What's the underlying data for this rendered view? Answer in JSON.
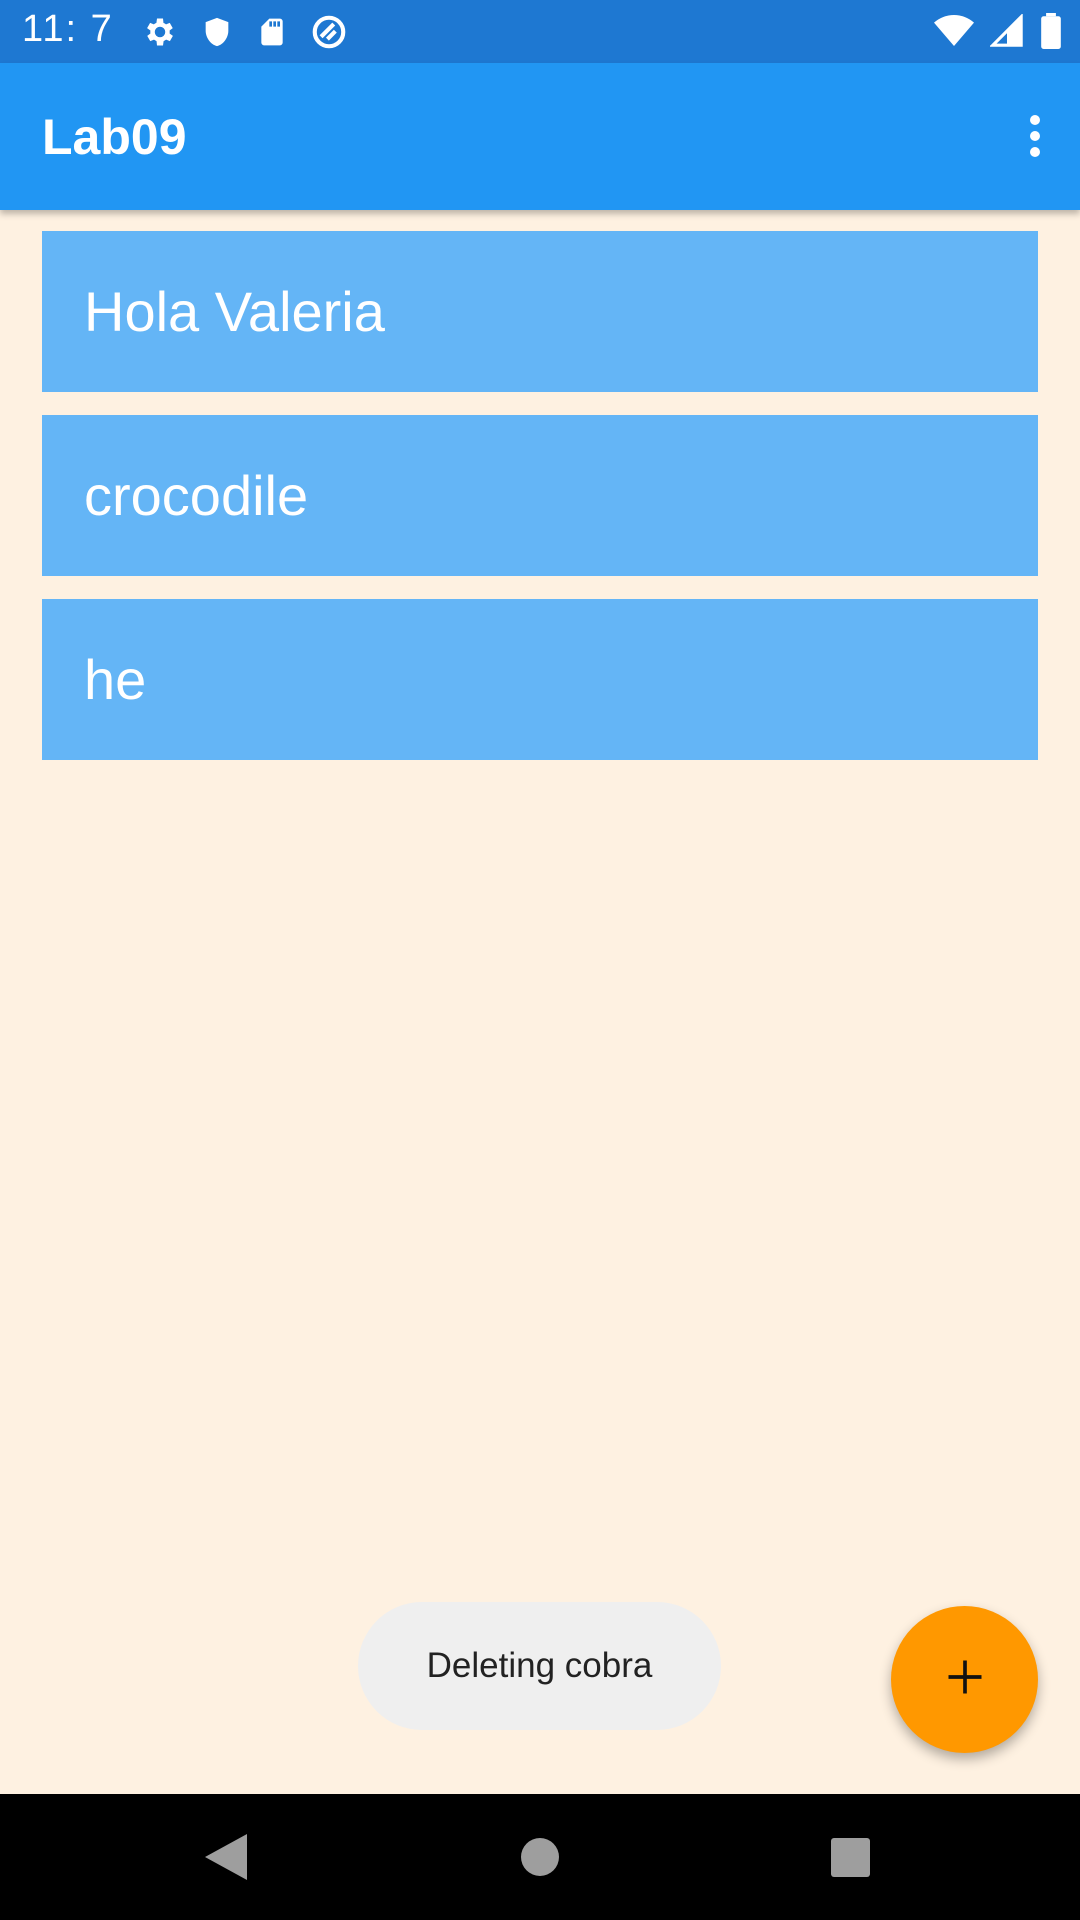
{
  "status_bar": {
    "time": "11:  7",
    "left_icons": [
      "settings-icon",
      "shield-icon",
      "sd-card-icon",
      "sync-icon"
    ],
    "right_icons": [
      "wifi-icon",
      "signal-icon",
      "battery-icon"
    ]
  },
  "app_bar": {
    "title": "Lab09",
    "menu_icon": "more-vert-icon"
  },
  "list": {
    "items": [
      {
        "label": "Hola Valeria"
      },
      {
        "label": "crocodile"
      },
      {
        "label": "he"
      }
    ]
  },
  "toast": {
    "message": "Deleting cobra"
  },
  "fab": {
    "icon": "add-icon"
  },
  "nav_bar": {
    "buttons": [
      "back-icon",
      "home-icon",
      "recents-icon"
    ]
  },
  "colors": {
    "status_bar": "#1E78D2",
    "app_bar": "#2196F3",
    "background": "#FEF1E1",
    "list_item": "#64B5F6",
    "fab": "#FF9800",
    "toast": "#EFEFEF"
  }
}
